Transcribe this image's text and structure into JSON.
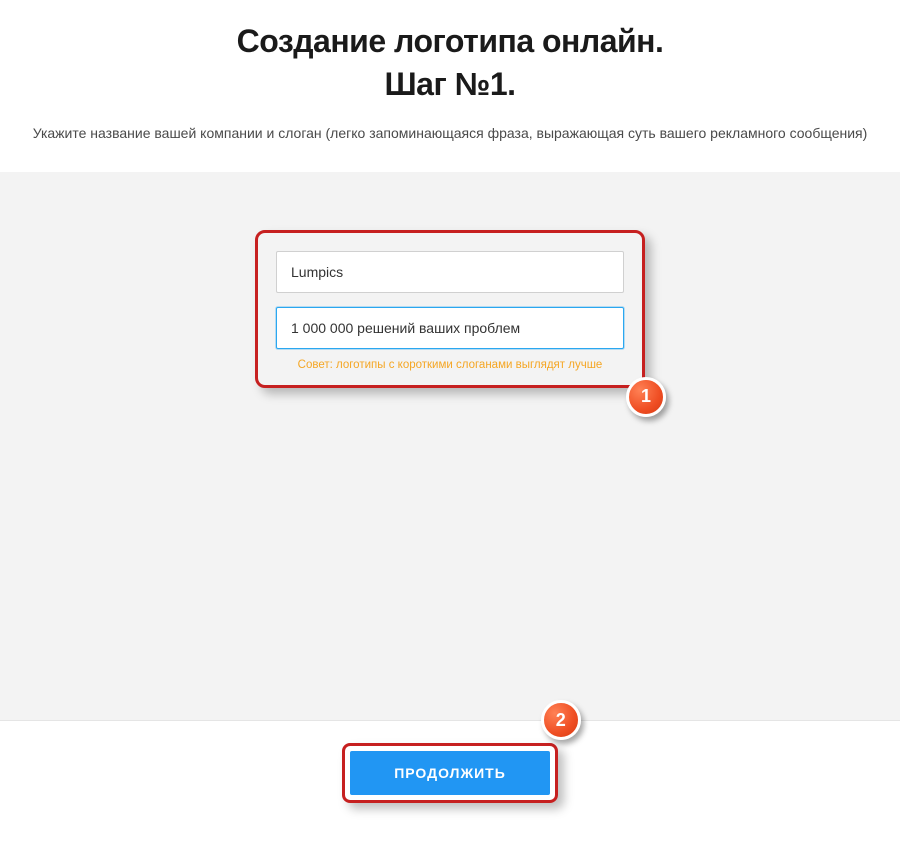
{
  "header": {
    "title_line1": "Создание логотипа онлайн.",
    "title_line2": "Шаг №1.",
    "subtitle": "Укажите название вашей компании и слоган (легко запоминающаяся фраза, выражающая суть вашего рекламного сообщения)"
  },
  "form": {
    "company_value": "Lumpics",
    "slogan_value": "1 000 000 решений ваших проблем",
    "hint": "Совет: логотипы с короткими слоганами выглядят лучше"
  },
  "annotations": {
    "badge1": "1",
    "badge2": "2"
  },
  "footer": {
    "continue_label": "ПРОДОЛЖИТЬ"
  }
}
